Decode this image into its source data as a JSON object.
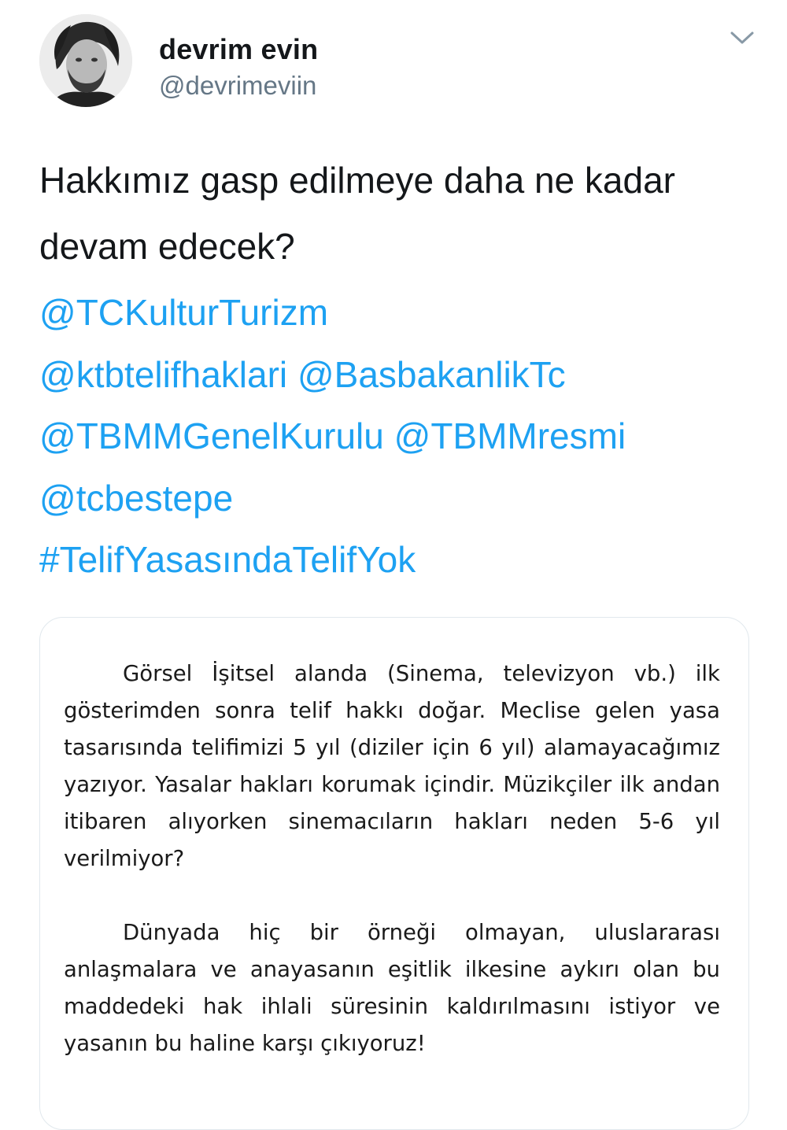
{
  "author": {
    "name": "devrim evin",
    "handle": "@devrimeviin",
    "avatar_icon": "profile-photo"
  },
  "menu_icon": "chevron-down-icon",
  "tweet": {
    "text_lines": [
      "Hakkımız gasp edilmeye daha ne kadar",
      "devam edecek?"
    ],
    "mentions": {
      "m1": "@TCKulturTurizm",
      "m2": "@ktbtelifhaklari",
      "m3": "@BasbakanlikTc",
      "m4": "@TBMMGenelKurulu",
      "m5": "@TBMMresmi",
      "m6": "@tcbestepe",
      "hashtag": "#TelifYasasındaTelifYok"
    }
  },
  "media": {
    "paragraph_1": "Görsel İşitsel alanda (Sinema, televizyon vb.) ilk gösterimden sonra telif hakkı doğar. Meclise gelen yasa tasarısında telifimizi 5 yıl (diziler için 6 yıl) alamayacağımız yazıyor. Yasalar hakları korumak içindir. Müzikçiler ilk andan itibaren alıyorken sinemacıların hakları neden 5-6 yıl verilmiyor?",
    "paragraph_2": "Dünyada hiç bir örneği olmayan, uluslararası anlaşmalara ve anayasanın eşitlik ilkesine aykırı olan bu maddedeki hak ihlali süresinin kaldırılmasını istiyor ve yasanın bu haline karşı çıkıyoruz!"
  },
  "colors": {
    "link": "#1da1f2",
    "text": "#14171a",
    "secondary": "#657786",
    "border": "#e1e8ed"
  }
}
